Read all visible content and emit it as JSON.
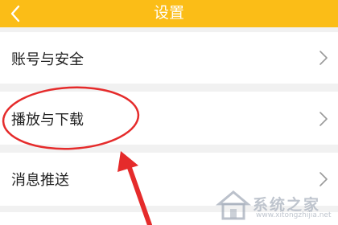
{
  "header": {
    "title": "设置",
    "back_icon": "chevron-left-icon",
    "background_color": "#fbbd17"
  },
  "settings": {
    "items": [
      {
        "label": "账号与安全",
        "icon": "chevron-right-icon"
      },
      {
        "label": "播放与下载",
        "icon": "chevron-right-icon"
      },
      {
        "label": "消息推送",
        "icon": "chevron-right-icon"
      }
    ]
  },
  "annotation": {
    "color": "#e52b2b",
    "highlighted_item": "播放与下载"
  },
  "watermark": {
    "text": "系统之家",
    "url": "www.xitongzhijia.net"
  }
}
